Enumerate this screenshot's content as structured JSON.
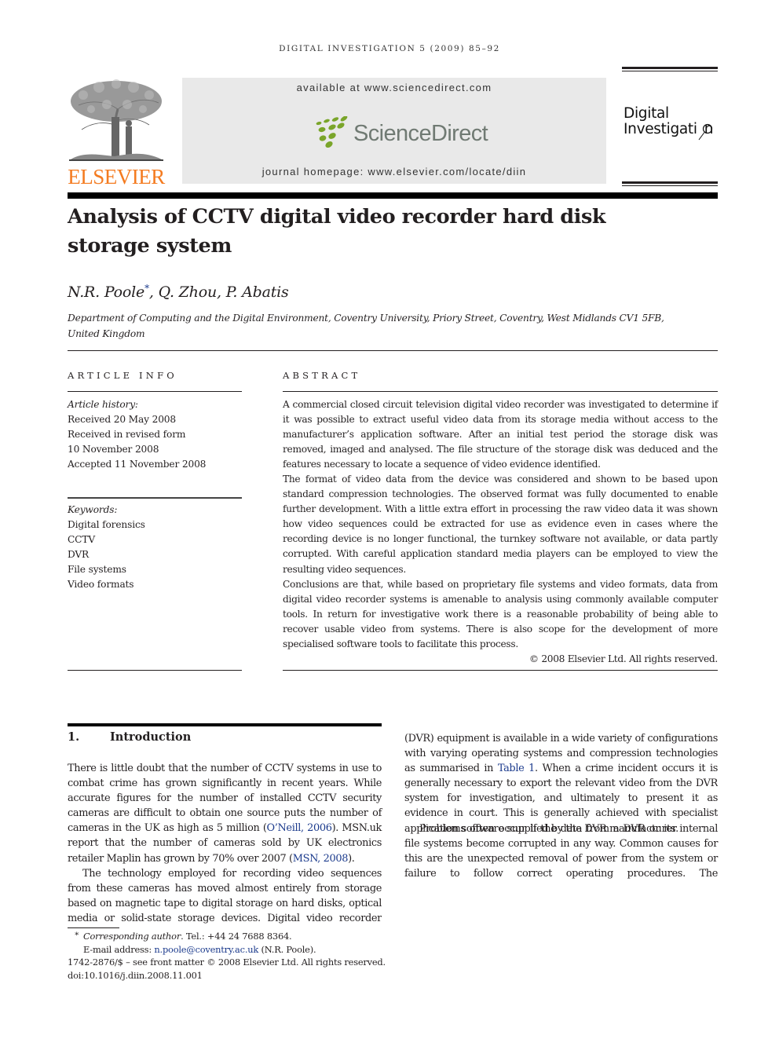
{
  "running_head": "DIGITAL INVESTIGATION 5 (2009) 85–92",
  "header": {
    "publisher_logo": "ELSEVIER",
    "publisher_logo_color": "#f47b20",
    "available_at": "available at www.sciencedirect.com",
    "sciencedirect_logo": "ScienceDirect",
    "sciencedirect_dot_color": "#7aa52a",
    "journal_homepage": "journal homepage: www.elsevier.com/locate/diin",
    "journal_logo_line1": "Digital",
    "journal_logo_line2": "Investigati",
    "journal_logo_line2_end": "n"
  },
  "article": {
    "title": "Analysis of CCTV digital video recorder hard disk storage system",
    "authors": [
      {
        "name": "N.R. Poole",
        "mark": "*"
      },
      {
        "name": "Q. Zhou"
      },
      {
        "name": "P. Abatis"
      }
    ],
    "author_separator": ", ",
    "affiliation": "Department of Computing and the Digital Environment, Coventry University, Priory Street, Coventry, West Midlands CV1 5FB, United Kingdom"
  },
  "article_info": {
    "heading": "ARTICLE INFO",
    "history_label": "Article history:",
    "history": [
      "Received 20 May 2008",
      "Received in revised form",
      "10 November 2008",
      "Accepted 11 November 2008"
    ],
    "keywords_label": "Keywords:",
    "keywords": [
      "Digital forensics",
      "CCTV",
      "DVR",
      "File systems",
      "Video formats"
    ]
  },
  "abstract": {
    "heading": "ABSTRACT",
    "paragraphs": [
      "A commercial closed circuit television digital video recorder was investigated to determine if it was possible to extract useful video data from its storage media without access to the manufacturer’s application software. After an initial test period the storage disk was removed, imaged and analysed. The file structure of the storage disk was deduced and the features necessary to locate a sequence of video evidence identified.",
      "The format of video data from the device was considered and shown to be based upon standard compression technologies. The observed format was fully documented to enable further development. With a little extra effort in processing the raw video data it was shown how video sequences could be extracted for use as evidence even in cases where the recording device is no longer functional, the turnkey software not available, or data partly corrupted. With careful application standard media players can be employed to view the resulting video sequences.",
      "Conclusions are that, while based on proprietary file systems and video formats, data from digital video recorder systems is amenable to analysis using commonly available computer tools. In return for investigative work there is a reasonable probability of being able to recover usable video from systems. There is also scope for the development of more specialised software tools to facilitate this process."
    ],
    "copyright": "© 2008 Elsevier Ltd. All rights reserved."
  },
  "introduction": {
    "number": "1.",
    "heading": "Introduction",
    "p1_a": "There is little doubt that the number of CCTV systems in use to combat crime has grown significantly in recent years. While accurate figures for the number of installed CCTV security cameras are difficult to obtain one source puts the number of cameras in the UK as high as 5 million (",
    "p1_link1": "O’Neill, 2006",
    "p1_b": "). MSN.uk report that the number of cameras sold by UK electronics retailer Maplin has grown by 70% over 2007 (",
    "p1_link2": "MSN, 2008",
    "p1_c": ").",
    "p2_a": "The technology employed for recording video sequences from these cameras has moved almost entirely from storage based on magnetic tape to digital storage on hard disks, optical media or solid-state storage devices. Digital video recorder (DVR) equipment is available in a wide variety of configurations with varying operating systems and compression technologies as summarised in ",
    "p2_link": "Table 1",
    "p2_b": ". When a crime incident occurs it is generally necessary to export the relevant video from the DVR system for investigation, and ultimately to present it as evidence in court. This is generally achieved with specialist application software supplied by the DVR manufacturer.",
    "p3": "Problems often occur if the data from a DVR or its internal file systems become corrupted in any way. Common causes for this are the unexpected removal of power from the system or failure to follow correct operating procedures. The"
  },
  "footnotes": {
    "mark": "*",
    "corresponding_label": "Corresponding author",
    "tel": ". Tel.: +44 24 7688 8364.",
    "email_label": "E-mail address: ",
    "email": "n.poole@coventry.ac.uk",
    "email_owner": " (N.R. Poole).",
    "front_matter": "1742-2876/$ – see front matter © 2008 Elsevier Ltd. All rights reserved.",
    "doi": "doi:10.1016/j.diin.2008.11.001"
  },
  "colors": {
    "link": "#1b3a8c",
    "text": "#231f20",
    "sd_panel": "#e9e9e9"
  }
}
